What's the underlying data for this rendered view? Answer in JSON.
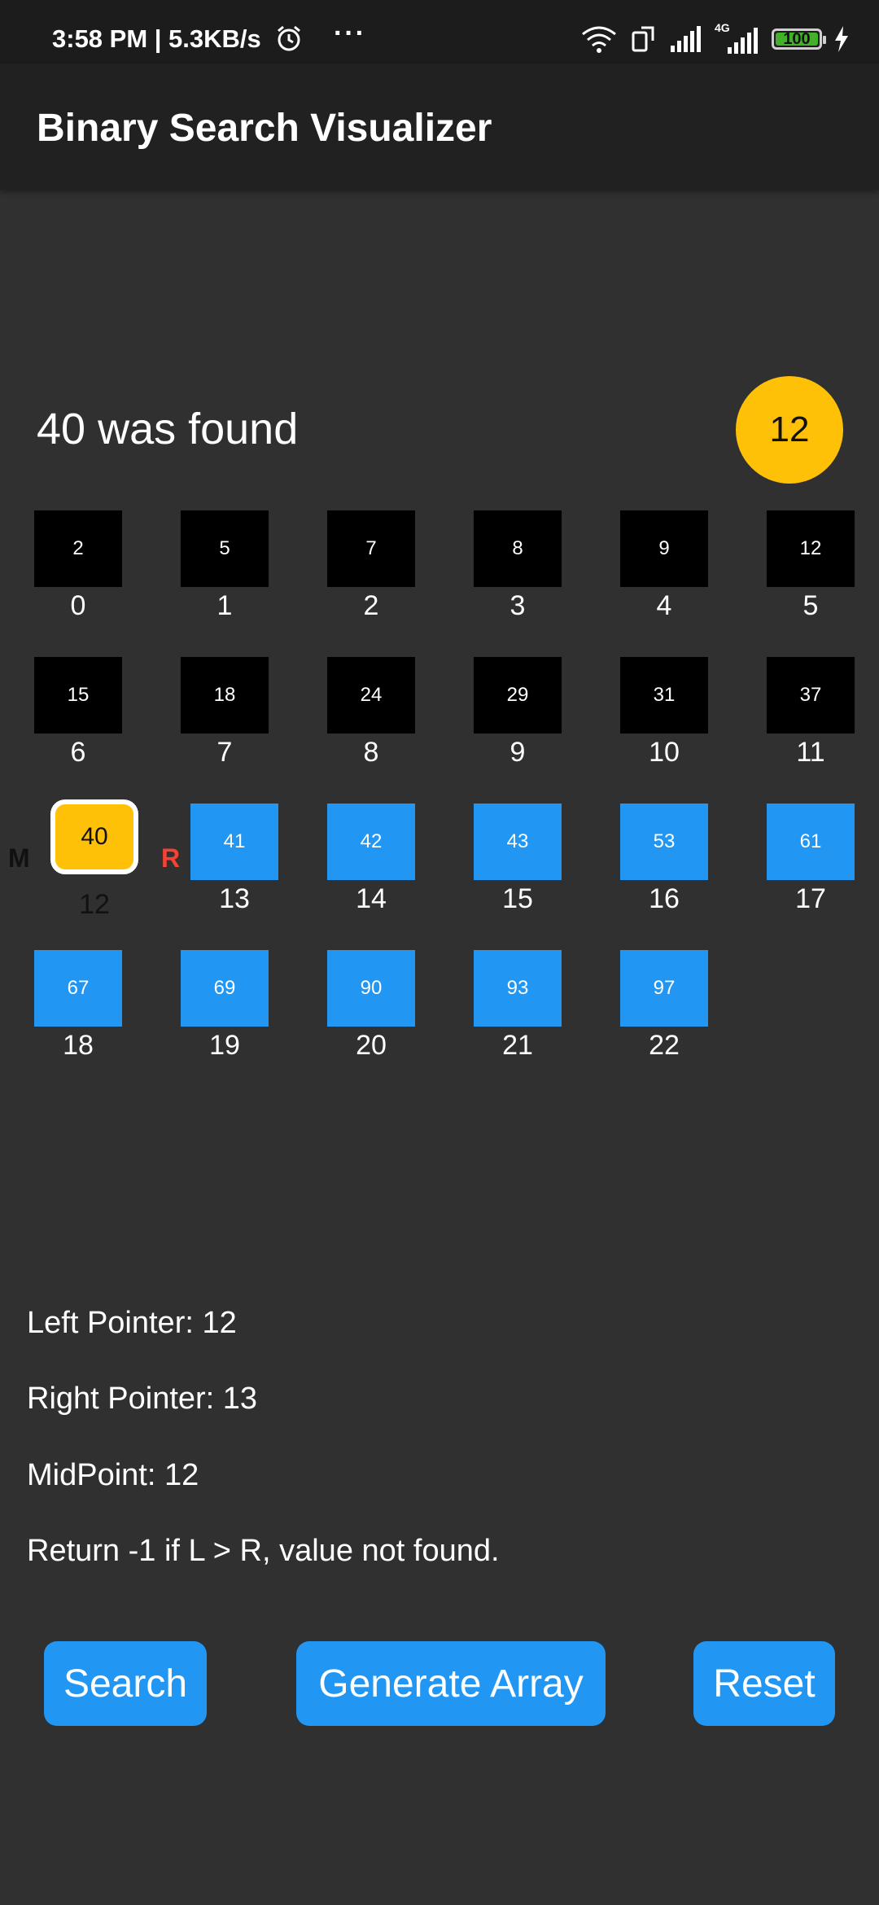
{
  "status_bar": {
    "time": "3:58 PM | 5.3KB/s",
    "more": "···",
    "network": "4G",
    "battery": "100",
    "icons": [
      "alarm-icon",
      "wifi-icon",
      "rotate-icon",
      "signal-icon",
      "signal-4g-icon",
      "battery-icon",
      "charging-icon"
    ]
  },
  "app": {
    "title": "Binary Search Visualizer"
  },
  "result": {
    "message": "40 was found",
    "target": "12"
  },
  "cells": [
    {
      "value": "2",
      "index": "0",
      "state": "discarded"
    },
    {
      "value": "5",
      "index": "1",
      "state": "discarded"
    },
    {
      "value": "7",
      "index": "2",
      "state": "discarded"
    },
    {
      "value": "8",
      "index": "3",
      "state": "discarded"
    },
    {
      "value": "9",
      "index": "4",
      "state": "discarded"
    },
    {
      "value": "12",
      "index": "5",
      "state": "discarded"
    },
    {
      "value": "15",
      "index": "6",
      "state": "discarded"
    },
    {
      "value": "18",
      "index": "7",
      "state": "discarded"
    },
    {
      "value": "24",
      "index": "8",
      "state": "discarded"
    },
    {
      "value": "29",
      "index": "9",
      "state": "discarded"
    },
    {
      "value": "31",
      "index": "10",
      "state": "discarded"
    },
    {
      "value": "37",
      "index": "11",
      "state": "discarded"
    },
    {
      "value": "40",
      "index": "12",
      "state": "mid"
    },
    {
      "value": "41",
      "index": "13",
      "state": "active"
    },
    {
      "value": "42",
      "index": "14",
      "state": "active"
    },
    {
      "value": "43",
      "index": "15",
      "state": "active"
    },
    {
      "value": "53",
      "index": "16",
      "state": "active"
    },
    {
      "value": "61",
      "index": "17",
      "state": "active"
    },
    {
      "value": "67",
      "index": "18",
      "state": "active"
    },
    {
      "value": "69",
      "index": "19",
      "state": "active"
    },
    {
      "value": "90",
      "index": "20",
      "state": "active"
    },
    {
      "value": "93",
      "index": "21",
      "state": "active"
    },
    {
      "value": "97",
      "index": "22",
      "state": "active"
    }
  ],
  "pointers": {
    "mid_label": "M",
    "right_label": "R"
  },
  "info": {
    "left": "Left Pointer: 12",
    "right": "Right Pointer: 13",
    "mid": "MidPoint: 12",
    "note": "Return -1 if L > R, value not found."
  },
  "buttons": {
    "search": "Search",
    "generate": "Generate Array",
    "reset": "Reset"
  },
  "colors": {
    "background": "#303030",
    "app_bar": "#212121",
    "discarded": "#000000",
    "active": "#2196f3",
    "mid": "#ffc107",
    "right_pointer": "#f44336"
  }
}
